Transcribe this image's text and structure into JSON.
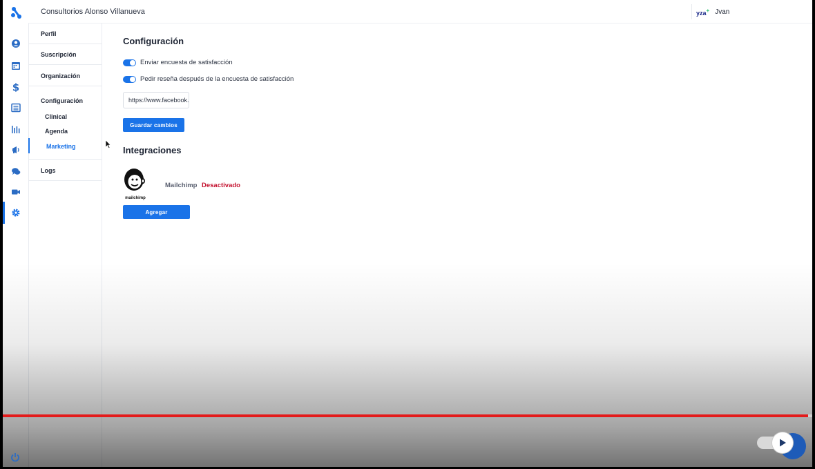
{
  "header": {
    "org_name": "Consultorios Alonso Villanueva",
    "user_brand": "yza",
    "user_name": "Jvan"
  },
  "submenu": {
    "items": [
      "Perfil",
      "Suscripción",
      "Organización",
      "Configuración",
      "Logs"
    ],
    "config_children": [
      "Clinical",
      "Agenda",
      "Marketing"
    ],
    "active_child": "Marketing"
  },
  "config": {
    "title": "Configuración",
    "toggle_1": "Enviar encuesta de satisfacción",
    "toggle_2": "Pedir reseña después de la encuesta de satisfacción",
    "url_value": "https://www.facebook.",
    "save_label": "Guardar cambios"
  },
  "integrations": {
    "title": "Integraciones",
    "logo_text": "mailchimp",
    "name": "Mailchimp",
    "status": "Desactivado",
    "add_label": "Agregar"
  },
  "colors": {
    "accent": "#1a73e8",
    "status_off": "#c4122f",
    "progress": "#e41b1b"
  },
  "icons": [
    "app-logo-icon",
    "user-icon",
    "calendar-icon",
    "dollar-icon",
    "list-icon",
    "chart-icon",
    "megaphone-icon",
    "chat-icon",
    "video-icon",
    "gear-icon",
    "power-icon",
    "play-icon"
  ]
}
